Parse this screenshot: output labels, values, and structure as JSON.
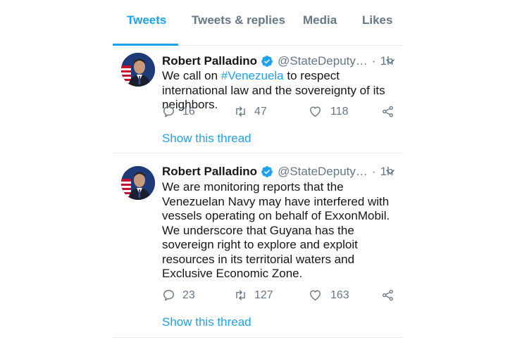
{
  "tabs": [
    {
      "label": "Tweets"
    },
    {
      "label": "Tweets & replies"
    },
    {
      "label": "Media"
    },
    {
      "label": "Likes"
    }
  ],
  "colors": {
    "accent": "#1da1f2",
    "secondary_text": "#657786",
    "primary_text": "#14171a"
  },
  "tweets": [
    {
      "name": "Robert Palladino",
      "handle": "@StateDeputy…",
      "separator": "·",
      "time": "1h",
      "text_before": "We call on ",
      "hashtag": "#Venezuela",
      "text_after": " to respect international law and the sovereignty of its neighbors.",
      "replies": "16",
      "retweets": "47",
      "likes": "118",
      "show_thread": "Show this thread"
    },
    {
      "name": "Robert Palladino",
      "handle": "@StateDeputy…",
      "separator": "·",
      "time": "1h",
      "text": "We are monitoring reports that the Venezuelan Navy may have interfered with vessels operating on behalf of ExxonMobil.  We underscore that Guyana has the sovereign right to explore and exploit resources in its territorial waters and Exclusive Economic Zone.",
      "replies": "23",
      "retweets": "127",
      "likes": "163",
      "show_thread": "Show this thread"
    }
  ],
  "icons": {
    "verified": "verified-badge-icon",
    "caret": "chevron-down-icon",
    "reply": "reply-icon",
    "retweet": "retweet-icon",
    "like": "heart-icon",
    "share": "share-icon"
  }
}
